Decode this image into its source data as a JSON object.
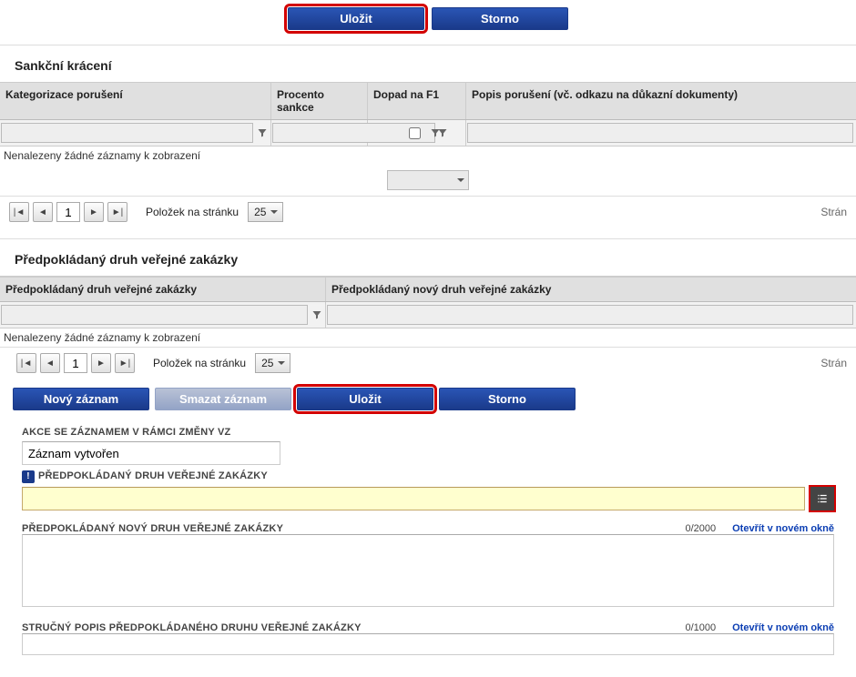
{
  "top": {
    "save_label": "Uložit",
    "cancel_label": "Storno"
  },
  "section1": {
    "title": "Sankční krácení",
    "cols": {
      "c1": "Kategorizace porušení",
      "c2": "Procento sankce",
      "c3": "Dopad na F1",
      "c4": "Popis porušení (vč. odkazu na důkazní dokumenty)"
    },
    "no_records": "Nenalezeny žádné záznamy k zobrazení",
    "per_page_label": "Položek na stránku",
    "per_page_value": "25",
    "page": "1",
    "page_right": "Strán"
  },
  "section2": {
    "title": "Předpokládaný druh veřejné zakázky",
    "cols": {
      "c1": "Předpokládaný druh veřejné zakázky",
      "c2": "Předpokládaný nový druh veřejné zakázky"
    },
    "no_records": "Nenalezeny žádné záznamy k zobrazení",
    "per_page_label": "Položek na stránku",
    "per_page_value": "25",
    "page": "1",
    "page_right": "Strán"
  },
  "actions": {
    "new": "Nový záznam",
    "delete": "Smazat záznam",
    "save": "Uložit",
    "cancel": "Storno"
  },
  "form": {
    "f1_label": "AKCE SE ZÁZNAMEM V RÁMCI ZMĚNY VZ",
    "f1_value": "Záznam vytvořen",
    "f2_label": "PŘEDPOKLÁDANÝ DRUH VEŘEJNÉ ZAKÁZKY",
    "f3_label": "PŘEDPOKLÁDANÝ NOVÝ DRUH VEŘEJNÉ ZAKÁZKY",
    "f3_counter": "0/2000",
    "f4_label": "STRUČNÝ POPIS PŘEDPOKLÁDANÉHO DRUHU VEŘEJNÉ ZAKÁZKY",
    "f4_counter": "0/1000",
    "open_link": "Otevřít v novém okně"
  }
}
